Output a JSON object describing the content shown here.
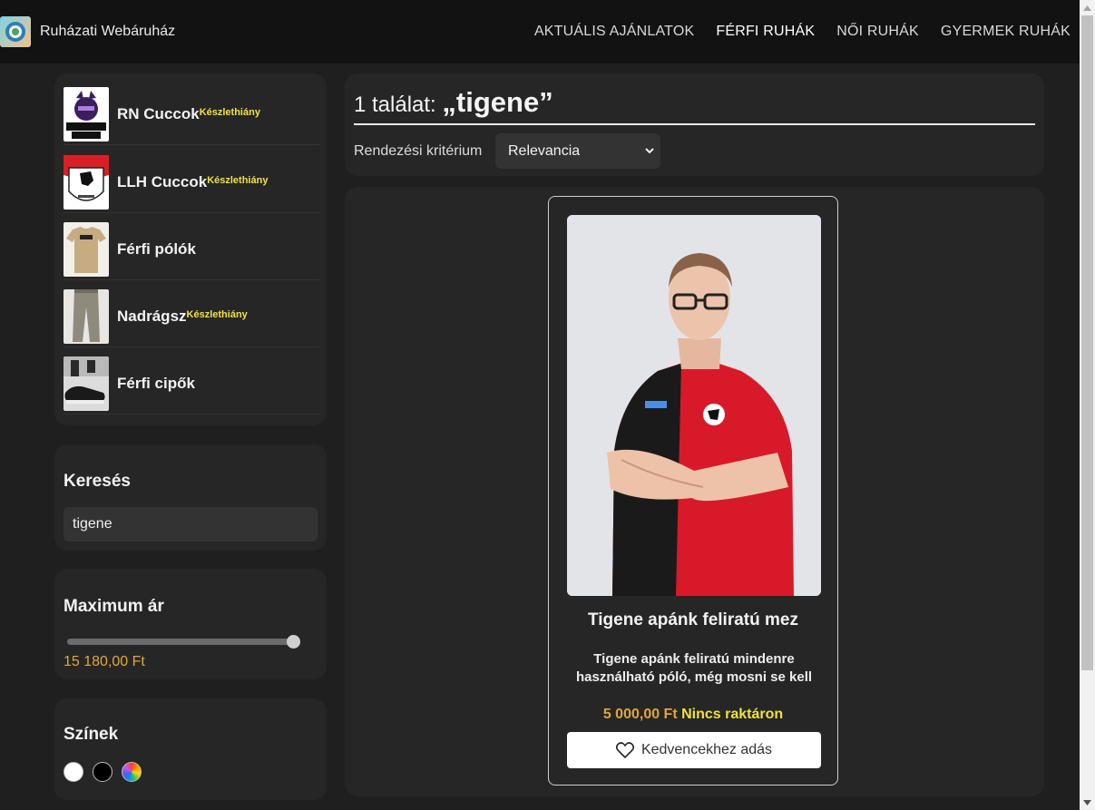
{
  "navbar": {
    "brand": "Ruházati Webáruház",
    "links": [
      "AKTUÁLIS AJÁNLATOK",
      "FÉRFI RUHÁK",
      "NŐI RUHÁK",
      "GYERMEK RUHÁK"
    ],
    "active": "FÉRFI RUHÁK"
  },
  "sidebar": {
    "categories": [
      {
        "label": "RN Cuccok",
        "badge": "Készlethiány"
      },
      {
        "label": "LLH Cuccok",
        "badge": "Készlethiány"
      },
      {
        "label": "Férfi pólók",
        "badge": ""
      },
      {
        "label": "Nadrágsz",
        "badge": "Készlethiány"
      },
      {
        "label": "Férfi cipők",
        "badge": ""
      }
    ],
    "search": {
      "title": "Keresés",
      "value": "tigene"
    },
    "price": {
      "title": "Maximum ár",
      "value": "15 180,00 Ft",
      "slider_fraction": 1.0
    },
    "colors": {
      "title": "Színek",
      "swatches": [
        "#ffffff",
        "#000000",
        "rainbow"
      ]
    }
  },
  "results": {
    "count_label": "1 találat: ",
    "query_label": "„tigene”",
    "sort_label": "Rendezési kritérium",
    "sort_value": "Relevancia"
  },
  "product": {
    "name": "Tigene apánk feliratú mez",
    "description": "Tigene apánk feliratú mindenre használható póló, még mosni se kell",
    "price": "5 000,00 Ft",
    "stock": "Nincs raktáron",
    "fav_button": "Kedvencekhez adás",
    "fav_icon": "heart-icon"
  },
  "colors": {
    "navbar_bg": "#121212",
    "page_bg": "#1f1f1f",
    "card_bg": "#262626",
    "price": "#e0a63c",
    "badge": "#f0e23a"
  }
}
